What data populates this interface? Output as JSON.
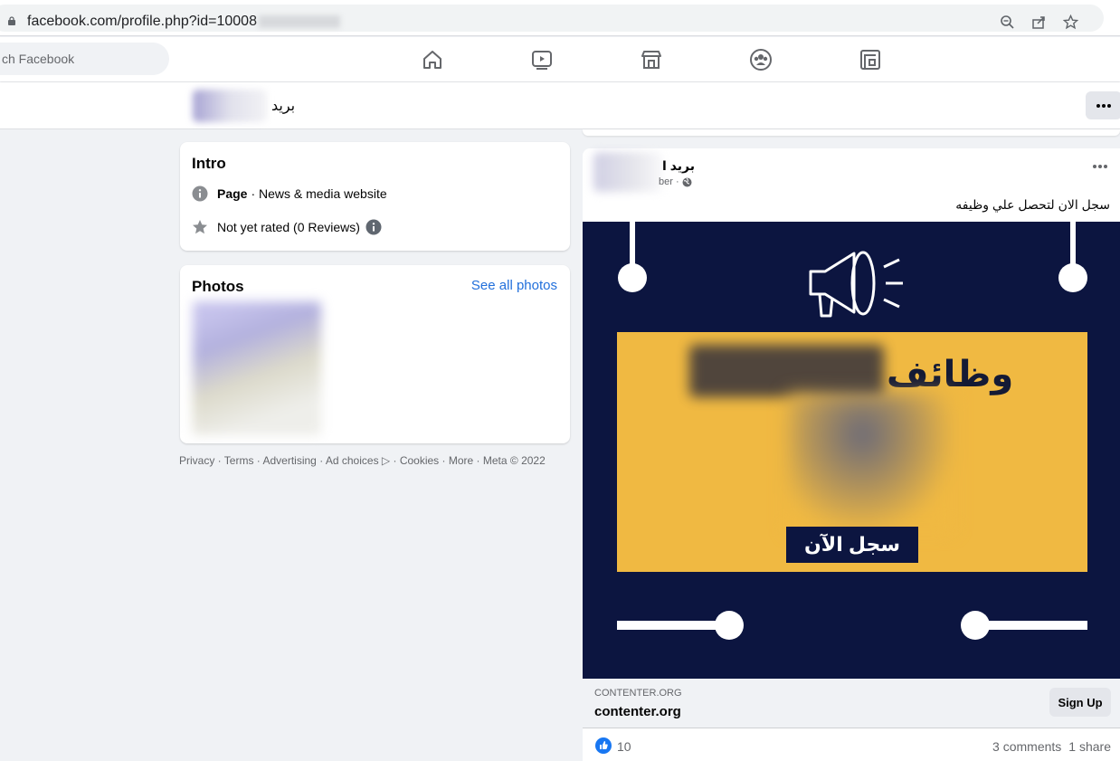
{
  "browser": {
    "url_text": "facebook.com/profile.php?id=10008",
    "icons": [
      "lock-icon",
      "zoom-icon",
      "share-icon",
      "star-icon"
    ]
  },
  "nav": {
    "search_placeholder": "ch Facebook",
    "icons": [
      "home-icon",
      "watch-icon",
      "marketplace-icon",
      "groups-icon",
      "gaming-icon"
    ]
  },
  "profile": {
    "name": "بريد"
  },
  "intro": {
    "title": "Intro",
    "category_label": "Page",
    "category_value": "· News & media website",
    "rating_text": "Not yet rated (0 Reviews)"
  },
  "photos": {
    "title": "Photos",
    "see_all": "See all photos"
  },
  "footer": {
    "items": [
      "Privacy",
      "Terms",
      "Advertising",
      "Ad choices",
      "Cookies",
      "More",
      "Meta © 2022"
    ]
  },
  "post": {
    "author": "بريد ا",
    "date_fragment": "ber ·",
    "text": "سجل الان لتحصل علي وظيفه",
    "ad_headline": "وظائف",
    "ad_button": "سجل الآن",
    "link_domain_small": "CONTENTER.ORG",
    "link_domain": "contenter.org",
    "cta": "Sign Up",
    "like_count": "10",
    "comments": "3 comments",
    "shares": "1 share"
  },
  "colors": {
    "fb_blue": "#216fdb",
    "ad_navy": "#0c1540",
    "ad_yellow": "#f0b942"
  }
}
